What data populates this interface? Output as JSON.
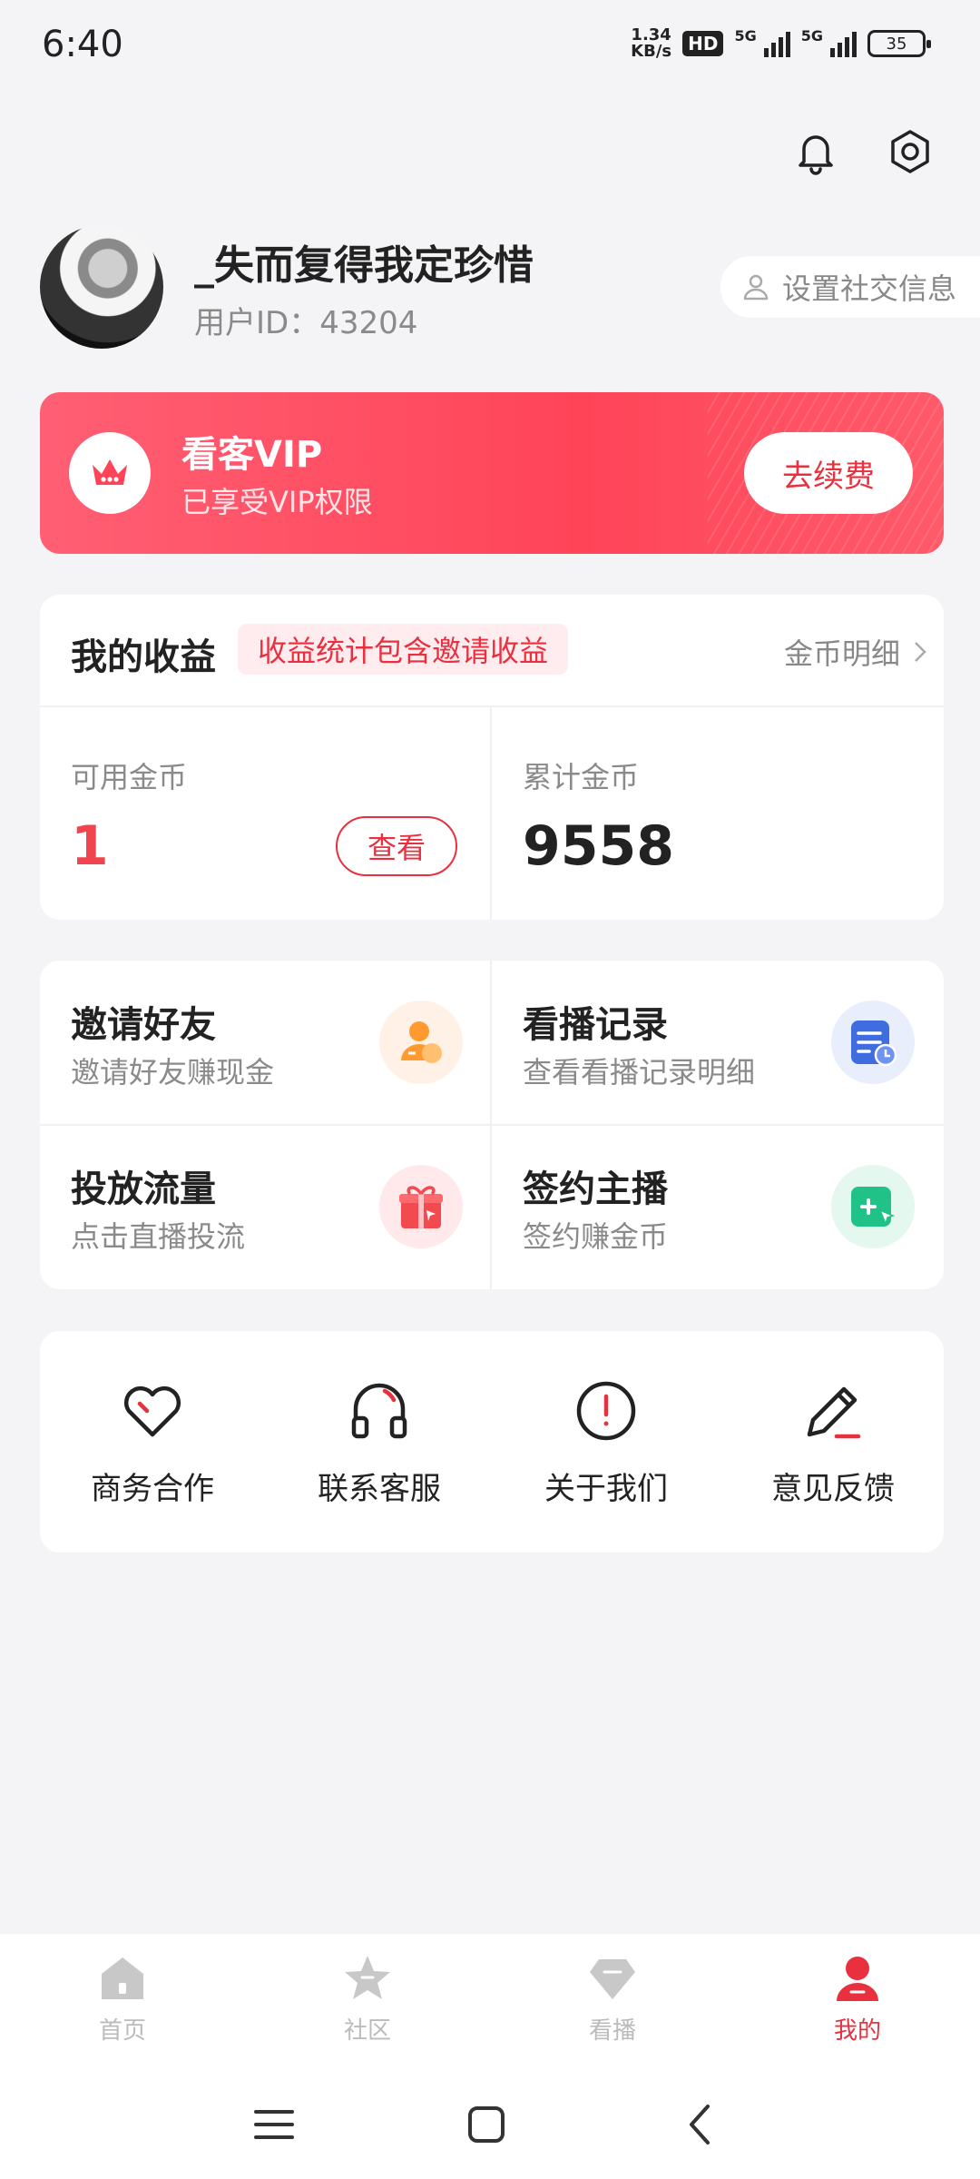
{
  "status_bar": {
    "time": "6:40",
    "speed_top": "1.34",
    "speed_bottom": "KB/s",
    "hd": "HD",
    "sig1": "5G",
    "sig2": "5G",
    "battery": "35"
  },
  "profile": {
    "username": "_失而复得我定珍惜",
    "user_id": "用户ID：43204",
    "social_button": "设置社交信息"
  },
  "vip": {
    "title": "看客VIP",
    "subtitle": "已享受VIP权限",
    "renew_button": "去续费",
    "accent": "#ff4458"
  },
  "earnings": {
    "title": "我的收益",
    "tag": "收益统计包含邀请收益",
    "detail_link": "金币明细",
    "available_label": "可用金币",
    "available_value": "1",
    "view_button": "查看",
    "total_label": "累计金币",
    "total_value": "9558"
  },
  "features": [
    {
      "title": "邀请好友",
      "subtitle": "邀请好友赚现金",
      "icon": "invite-friend-icon"
    },
    {
      "title": "看播记录",
      "subtitle": "查看看播记录明细",
      "icon": "watch-history-icon"
    },
    {
      "title": "投放流量",
      "subtitle": "点击直播投流",
      "icon": "gift-icon"
    },
    {
      "title": "签约主播",
      "subtitle": "签约赚金币",
      "icon": "sign-anchor-icon"
    }
  ],
  "tools": [
    {
      "label": "商务合作",
      "icon": "heart-icon"
    },
    {
      "label": "联系客服",
      "icon": "headset-icon"
    },
    {
      "label": "关于我们",
      "icon": "info-icon"
    },
    {
      "label": "意见反馈",
      "icon": "pencil-icon"
    }
  ],
  "tabs": [
    {
      "label": "首页",
      "icon": "home-icon",
      "active": false
    },
    {
      "label": "社区",
      "icon": "star-icon",
      "active": false
    },
    {
      "label": "看播",
      "icon": "diamond-icon",
      "active": false
    },
    {
      "label": "我的",
      "icon": "person-icon",
      "active": true
    }
  ]
}
